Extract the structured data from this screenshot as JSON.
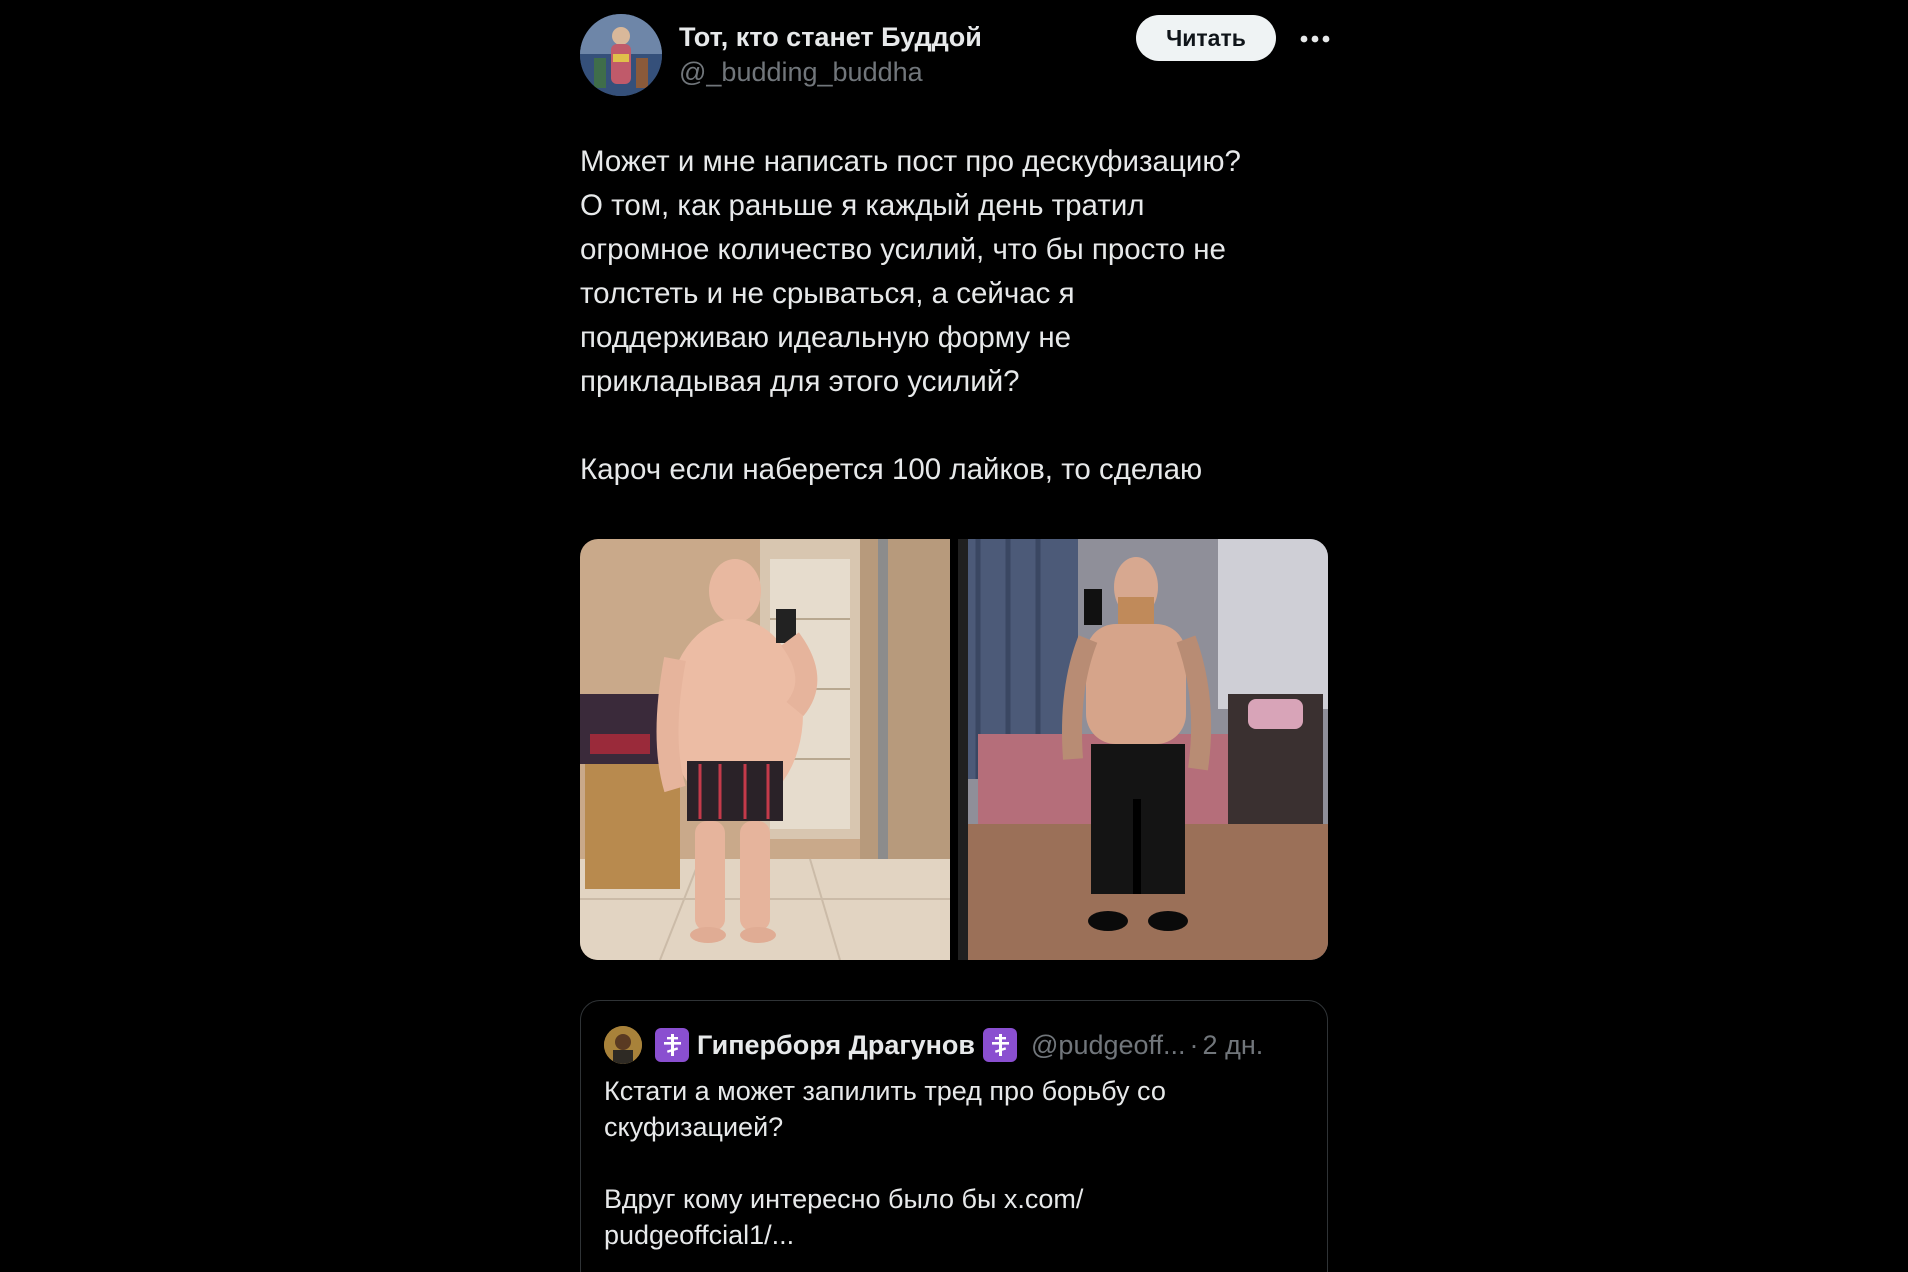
{
  "author": {
    "name": "Тот, кто станет Буддой",
    "handle": "@_budding_buddha"
  },
  "follow_button": "Читать",
  "more_icon": "more-horizontal-icon",
  "tweet": {
    "lines": [
      "Может и мне написать пост про дескуфизацию?",
      "О том, как раньше я каждый день тратил",
      "огромное количество усилий, что бы просто не",
      "толстеть и не срываться, а сейчас я",
      "поддерживаю идеальную форму не",
      "прикладывая для этого  усилий?",
      "Кароч если наберется 100 лайков, то сделаю"
    ]
  },
  "quote": {
    "name": "Гиперборя Драгунов",
    "handle": "@pudgeoff...",
    "separator": "·",
    "time": "2 дн.",
    "lines": [
      "Кстати а может запилить тред про борьбу со",
      "скуфизацией?",
      "Вдруг кому интересно было бы x.com/",
      "pudgeoffcial1/..."
    ]
  },
  "colors": {
    "background": "#000000",
    "text": "#e7e9ea",
    "secondary_text": "#71767b",
    "border": "#2f3336",
    "follow_button_bg": "#eff3f4",
    "cross_badge": "#8a4fd0"
  }
}
